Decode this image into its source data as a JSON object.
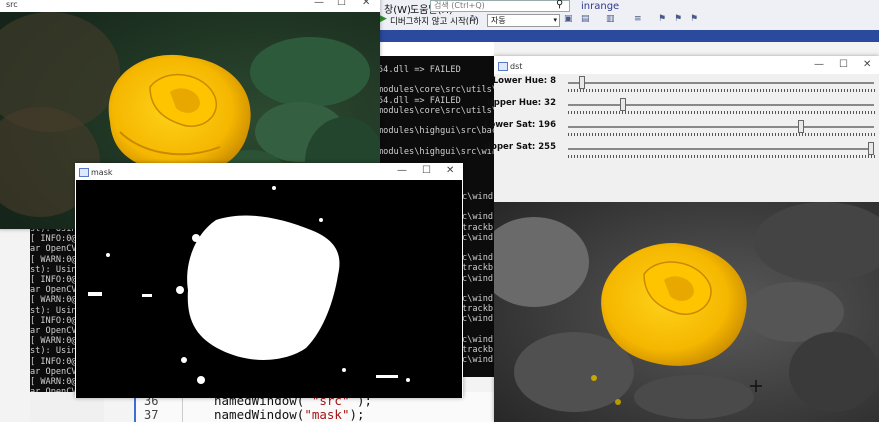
{
  "vs": {
    "menu": [
      "창(W)",
      "도움말(H)"
    ],
    "search_placeholder": "검색 (Ctrl+Q)",
    "toolbar_label": "디버그하지 않고 시작(H)",
    "config_value": "자동",
    "solution_name": "inrange"
  },
  "console": {
    "lines": [
      "54.dll => FAILED",
      "",
      "modules\\core\\src\\utils\\p",
      "54.dll => FAILED",
      "modules\\core\\src\\utils\\p",
      "",
      "modules\\highgui\\src\\back",
      "",
      "modules\\highgui\\src\\wind"
    ],
    "left_lines": [
      "st): Usin",
      "[ INFO:0@",
      "ar OpenCV",
      "[ WARN:0@",
      "st): Usin",
      "[ INFO:0@",
      "ar OpenCV",
      "[ WARN:0@",
      "st): Usin",
      "[ INFO:0@",
      "ar OpenCV",
      "[ WARN:0@",
      "st): Usin",
      "[ INFO:0@",
      "ar OpenCV",
      "[ WARN:0@",
      "ar OpenCV"
    ],
    "mid_lines": [
      "c\\wind",
      "",
      "c\\wind",
      "trackb",
      "c\\wind",
      "",
      "c\\wind",
      "trackb",
      "c\\wind",
      "",
      "c\\wind",
      "trackb",
      "c\\wind",
      "",
      "c\\wind",
      "trackb",
      "c\\wind"
    ]
  },
  "code": {
    "lines": [
      {
        "num": "36",
        "fn": "namedWindow(",
        "arg": "\"src\"",
        "end": ");"
      },
      {
        "num": "37",
        "fn": "namedWindow(",
        "arg": "\"mask\"",
        "end": ");"
      }
    ]
  },
  "windows": {
    "src": {
      "title": "src"
    },
    "mask": {
      "title": "mask"
    },
    "dst": {
      "title": "dst"
    }
  },
  "trackbars": [
    {
      "label": "Lower Hue: 8",
      "value": 8,
      "max": 179
    },
    {
      "label": "Upper Hue: 32",
      "value": 32,
      "max": 179
    },
    {
      "label": "Lower Sat: 196",
      "value": 196,
      "max": 255
    },
    {
      "label": "Upper Sat: 255",
      "value": 255,
      "max": 255
    }
  ],
  "window_controls": {
    "minimize": "—",
    "maximize": "☐",
    "close": "✕"
  }
}
